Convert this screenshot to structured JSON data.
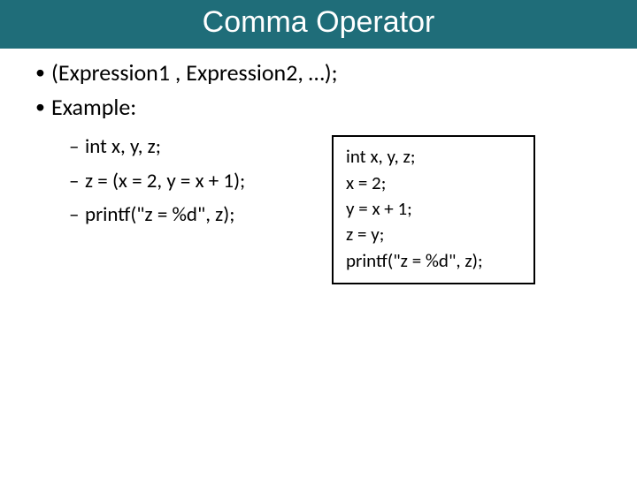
{
  "title": "Comma Operator",
  "bullets": {
    "syntax": "(Expression1 , Expression2, …);",
    "example_label": "Example:",
    "sub": {
      "line1": "int x, y, z;",
      "line2": "z = (x = 2, y = x + 1);",
      "line3": "printf(\"z = %d\", z);"
    }
  },
  "codebox": {
    "line1": "int x, y, z;",
    "line2": "x = 2;",
    "line3": "y = x + 1;",
    "line4": "z = y;",
    "line5": "printf(\"z = %d\", z);"
  }
}
